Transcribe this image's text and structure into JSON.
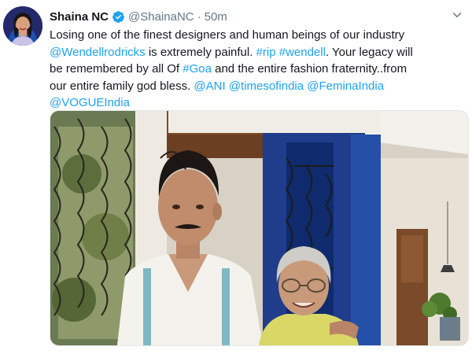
{
  "tweet": {
    "display_name": "Shaina NC",
    "handle": "@ShainaNC",
    "separator": "·",
    "timestamp": "50m",
    "lines": [
      [
        {
          "t": "Losing one of the finest designers and human beings of our industry",
          "link": false
        }
      ],
      [
        {
          "t": "@Wendellrodricks",
          "link": true
        },
        {
          "t": " is extremely painful. ",
          "link": false
        },
        {
          "t": "#rip",
          "link": true
        },
        {
          "t": " ",
          "link": false
        },
        {
          "t": "#wendell",
          "link": true
        },
        {
          "t": ". Your legacy will",
          "link": false
        }
      ],
      [
        {
          "t": "be remembered by all Of ",
          "link": false
        },
        {
          "t": "#Goa",
          "link": true
        },
        {
          "t": " and the entire fashion fraternity..from",
          "link": false
        }
      ],
      [
        {
          "t": "our entire family god bless. ",
          "link": false
        },
        {
          "t": "@ANI",
          "link": true
        },
        {
          "t": " ",
          "link": false
        },
        {
          "t": "@timesofindia",
          "link": true
        },
        {
          "t": " ",
          "link": false
        },
        {
          "t": "@FeminaIndia",
          "link": true
        }
      ],
      [
        {
          "t": "@VOGUEIndia",
          "link": true
        }
      ]
    ]
  },
  "icons": {
    "verified": "verified-badge-icon",
    "caret": "chevron-down-icon"
  },
  "colors": {
    "link": "#1da1f2",
    "secondary_text": "#657786",
    "primary_text": "#14171a",
    "verified": "#1da1f2"
  }
}
